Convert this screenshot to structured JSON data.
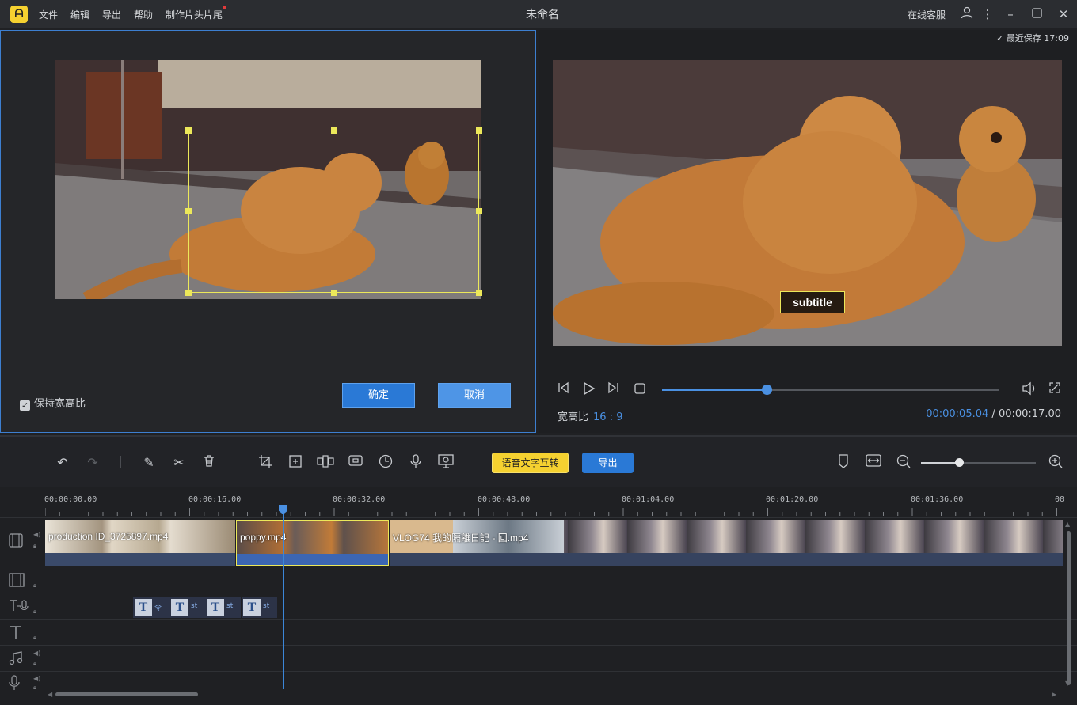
{
  "titlebar": {
    "logo": "ᗩ",
    "menu": [
      "文件",
      "编辑",
      "导出",
      "帮助",
      "制作片头片尾"
    ],
    "window_title": "未命名",
    "service": "在线客服"
  },
  "crop_panel": {
    "keep_ratio_label": "保持宽高比",
    "keep_ratio_checked": true,
    "confirm_label": "确定",
    "cancel_label": "取消"
  },
  "preview": {
    "saved_label": "最近保存 17:09",
    "subtitle_text": "subtitle",
    "aspect_label": "宽高比",
    "aspect_value": "16 : 9",
    "current_time": "00:00:05.04",
    "time_separator": "/",
    "total_time": "00:00:17.00",
    "progress_fraction": 0.311
  },
  "toolbar": {
    "speech_text_label": "语音文字互转",
    "export_label": "导出",
    "zoom_fraction": 0.33
  },
  "timeline": {
    "ruler": [
      "00:00:00.00",
      "00:00:16.00",
      "00:00:32.00",
      "00:00:48.00",
      "00:01:04.00",
      "00:01:20.00",
      "00:01:36.00",
      "00"
    ],
    "clips": [
      {
        "name": "production ID_3725897.mp4"
      },
      {
        "name": "poppy.mp4"
      },
      {
        "name": "VLOG74 我的隔離日記 - 回.mp4"
      }
    ],
    "text_clip_suffix": "st"
  },
  "colors": {
    "accent": "#4a90e2",
    "selection": "#ece85a",
    "highlight_button": "#f5d130"
  }
}
